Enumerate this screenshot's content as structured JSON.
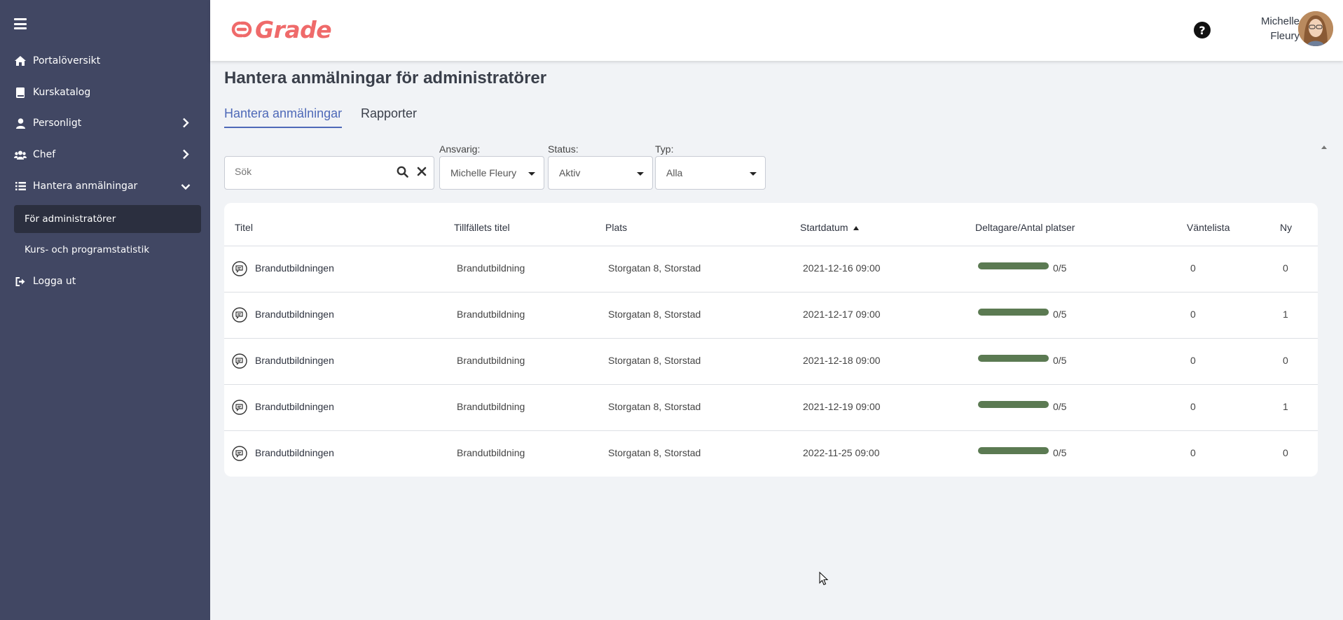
{
  "app": {
    "name": "Grade"
  },
  "sidebar": {
    "items": [
      {
        "label": "Portalöversikt",
        "icon": "home-icon"
      },
      {
        "label": "Kurskatalog",
        "icon": "book-icon"
      },
      {
        "label": "Personligt",
        "icon": "user-icon",
        "expandable": true
      },
      {
        "label": "Chef",
        "icon": "users-icon",
        "expandable": true
      },
      {
        "label": "Hantera anmälningar",
        "icon": "list-icon",
        "expanded": true
      }
    ],
    "subitems": [
      {
        "label": "För administratörer",
        "active": true
      },
      {
        "label": "Kurs- och programstatistik",
        "active": false
      }
    ],
    "logout": "Logga ut"
  },
  "header": {
    "user": {
      "first": "Michelle",
      "last": "Fleury"
    }
  },
  "main": {
    "title": "Hantera anmälningar för administratörer",
    "tabs": [
      {
        "label": "Hantera anmälningar",
        "active": true
      },
      {
        "label": "Rapporter",
        "active": false
      }
    ],
    "search": {
      "placeholder": "Sök",
      "value": ""
    },
    "filters": {
      "responsible": {
        "label": "Ansvarig:",
        "value": "Michelle Fleury"
      },
      "status": {
        "label": "Status:",
        "value": "Aktiv"
      },
      "type": {
        "label": "Typ:",
        "value": "Alla"
      }
    },
    "table": {
      "columns": [
        "Titel",
        "Tillfällets titel",
        "Plats",
        "Startdatum",
        "Deltagare/Antal platser",
        "Väntelista",
        "Ny"
      ],
      "sort": {
        "column": "Startdatum",
        "direction": "ascending"
      },
      "rows": [
        {
          "title": "Brandutbildningen",
          "occasion": "Brandutbildning",
          "place": "Storgatan 8, Storstad",
          "start": "2021-12-16 09:00",
          "participants": "0/5",
          "waitlist": "0",
          "new": "0"
        },
        {
          "title": "Brandutbildningen",
          "occasion": "Brandutbildning",
          "place": "Storgatan 8, Storstad",
          "start": "2021-12-17 09:00",
          "participants": "0/5",
          "waitlist": "0",
          "new": "1"
        },
        {
          "title": "Brandutbildningen",
          "occasion": "Brandutbildning",
          "place": "Storgatan 8, Storstad",
          "start": "2021-12-18 09:00",
          "participants": "0/5",
          "waitlist": "0",
          "new": "0"
        },
        {
          "title": "Brandutbildningen",
          "occasion": "Brandutbildning",
          "place": "Storgatan 8, Storstad",
          "start": "2021-12-19 09:00",
          "participants": "0/5",
          "waitlist": "0",
          "new": "1"
        },
        {
          "title": "Brandutbildningen",
          "occasion": "Brandutbildning",
          "place": "Storgatan 8, Storstad",
          "start": "2022-11-25 09:00",
          "participants": "0/5",
          "waitlist": "0",
          "new": "0"
        }
      ]
    }
  },
  "colors": {
    "sidebar_bg": "#414763",
    "sidebar_active": "#2b2f3f",
    "accent": "#4e69b8",
    "brand": "#ef6a6a",
    "progress_bar": "#5b7a52",
    "page_bg": "#f1f3f6"
  }
}
